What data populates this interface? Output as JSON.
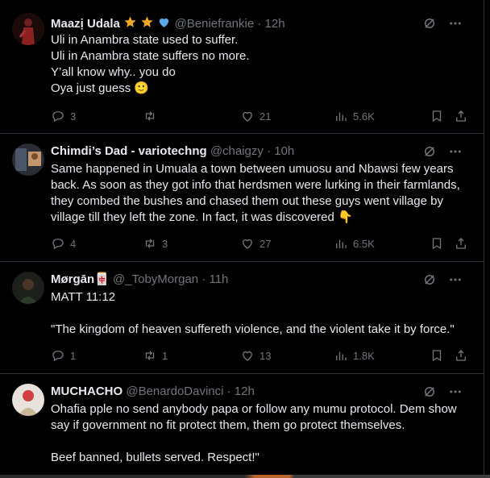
{
  "tweets": [
    {
      "name": "Maazị Udala",
      "badges": [
        "star",
        "star",
        "blue-heart"
      ],
      "handle": "@Beniefrankie",
      "time": "· 12h",
      "text": "Uli in Anambra state used to suffer.\nUli in Anambra state suffers no more.\nY’all know why.. you do\nOya just guess 🙂",
      "replies": "3",
      "reposts": "",
      "likes": "21",
      "views": "5.6K"
    },
    {
      "name": "Chimdi’s Dad - variotechng",
      "handle": "@chaigzy",
      "time": "· 10h",
      "text": "Same happened in Umuala a town between umuosu and Nbawsi few years back. As soon as they got info that herdsmen were lurking in their farmlands, they combed the bushes and chased them out these guys went village by village till they left the zone. In fact, it was discovered 👇",
      "replies": "4",
      "reposts": "3",
      "likes": "27",
      "views": "6.5K"
    },
    {
      "name": "Mørgān",
      "name_emoji": "🀄",
      "handle": "@_TobyMorgan",
      "time": "· 11h",
      "text": "MATT 11:12\n\n\"The kingdom of heaven suffereth violence, and the violent take it by force.\"",
      "replies": "1",
      "reposts": "1",
      "likes": "13",
      "views": "1.8K"
    },
    {
      "name": "MUCHACHO",
      "handle": "@BenardoDavinci",
      "time": "· 12h",
      "text": "Ohafia pple no send anybody papa or follow any mumu protocol. Dem show say if government no fit protect them, them go protect themselves.\n\nBeef banned, bullets served. Respect!\""
    }
  ],
  "colors": {
    "background": "#000000",
    "text": "#e7e9ea",
    "muted": "#71767b",
    "border": "#2f3336"
  }
}
